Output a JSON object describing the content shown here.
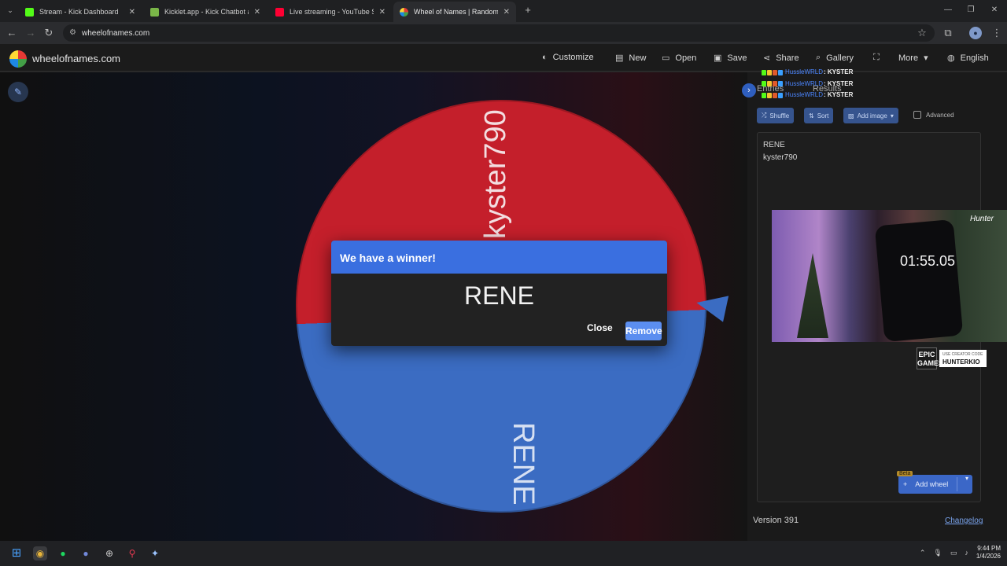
{
  "browser": {
    "tabs": [
      {
        "title": "Stream - Kick Dashboard",
        "favicon_color": "#53fc18",
        "active": false
      },
      {
        "title": "Kicklet.app - Kick Chatbot and",
        "favicon_color": "#7ab648",
        "active": false
      },
      {
        "title": "Live streaming - YouTube Studi",
        "favicon_color": "#ff0033",
        "active": false
      },
      {
        "title": "Wheel of Names | Random nam",
        "favicon_color": "#4caf50",
        "active": true
      }
    ],
    "new_tab": "+",
    "url": "wheelofnames.com"
  },
  "header": {
    "site_name": "wheelofnames.com",
    "buttons": {
      "customize": "Customize",
      "new": "New",
      "open": "Open",
      "save": "Save",
      "share": "Share",
      "gallery": "Gallery",
      "more": "More",
      "language": "English"
    }
  },
  "wheel": {
    "segments": [
      {
        "label": "kyster790",
        "color": "#c41f2b"
      },
      {
        "label": "RENE",
        "color": "#3b6cc2"
      }
    ]
  },
  "dialog": {
    "title": "We have a winner!",
    "winner": "RENE",
    "close": "Close",
    "remove": "Remove"
  },
  "panel": {
    "tabs": {
      "entries": "Entries",
      "results": "Results"
    },
    "shuffle": "Shuffle",
    "sort": "Sort",
    "add_image": "Add image",
    "advanced": "Advanced",
    "entries": [
      "RENE",
      "kyster790"
    ],
    "beta": "Beta",
    "add_wheel": "Add wheel",
    "version": "Version 391",
    "changelog": "Changelog"
  },
  "chat": [
    {
      "user": "HussleWRLD",
      "message": ": KYSTER"
    },
    {
      "user": "HussleWRLD",
      "message": ": KYSTER"
    },
    {
      "user": "HussleWRLD",
      "message": ": KYSTER"
    }
  ],
  "webcam": {
    "timer": "01:55.05",
    "tag": "Hunter",
    "epic_logo": "EPIC GAMES",
    "creator_label": "USE CREATOR CODE",
    "creator_code": "HUNTERKIO"
  },
  "taskbar": {
    "time": "9:44 PM",
    "date": "1/4/2026"
  }
}
